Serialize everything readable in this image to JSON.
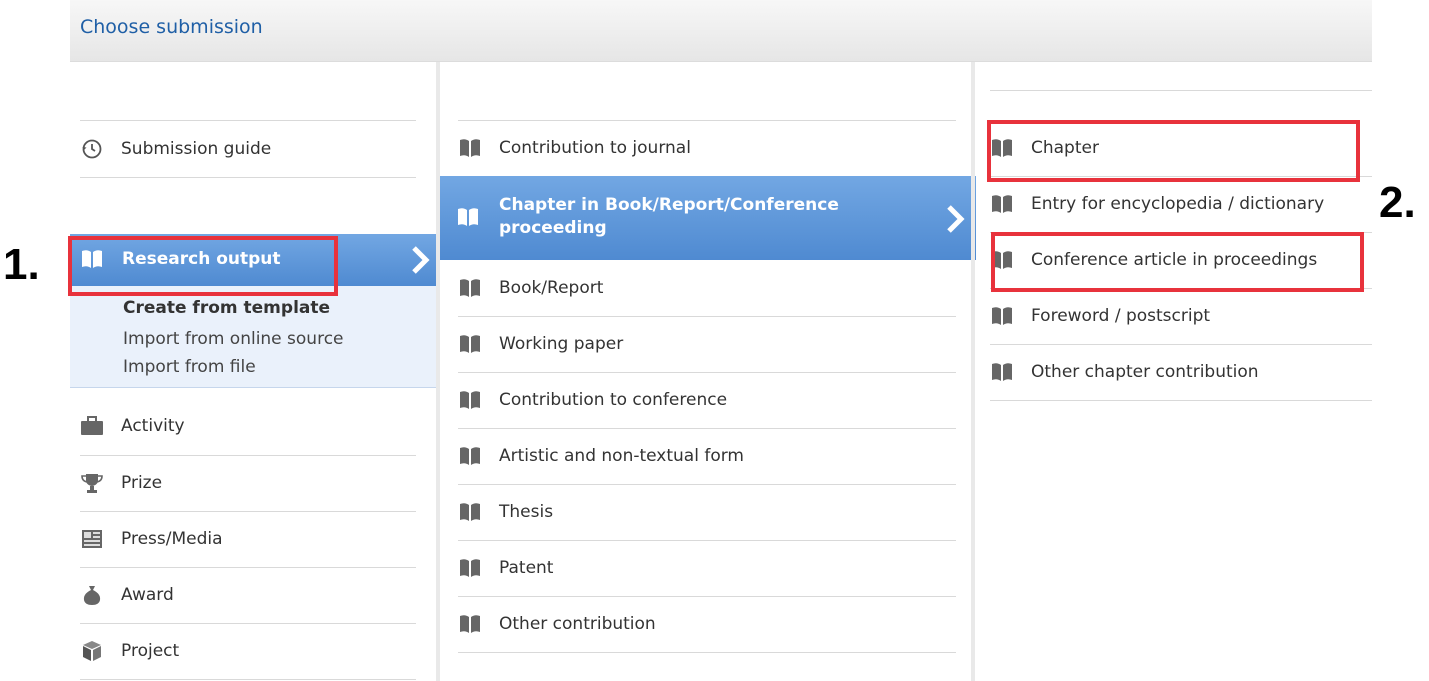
{
  "header": {
    "title": "Choose submission"
  },
  "left_menu": {
    "submission_guide": "Submission guide",
    "research_output": "Research output",
    "sub_items": [
      "Create from template",
      "Import from online source",
      "Import from file"
    ],
    "items": [
      "Activity",
      "Prize",
      "Press/Media",
      "Award",
      "Project"
    ]
  },
  "middle_menu": {
    "items": [
      "Contribution to journal",
      "Chapter in Book/Report/Conference proceeding",
      "Book/Report",
      "Working paper",
      "Contribution to conference",
      "Artistic and non-textual form",
      "Thesis",
      "Patent",
      "Other contribution"
    ]
  },
  "right_menu": {
    "items": [
      "Chapter",
      "Entry for encyclopedia / dictionary",
      "Conference article in proceedings",
      "Foreword / postscript",
      "Other chapter contribution"
    ]
  },
  "annotations": {
    "step1": "1.",
    "step2": "2."
  },
  "colors": {
    "accent": "#4f8ad1",
    "highlight": "#e8323c",
    "title": "#1f5fa6"
  }
}
